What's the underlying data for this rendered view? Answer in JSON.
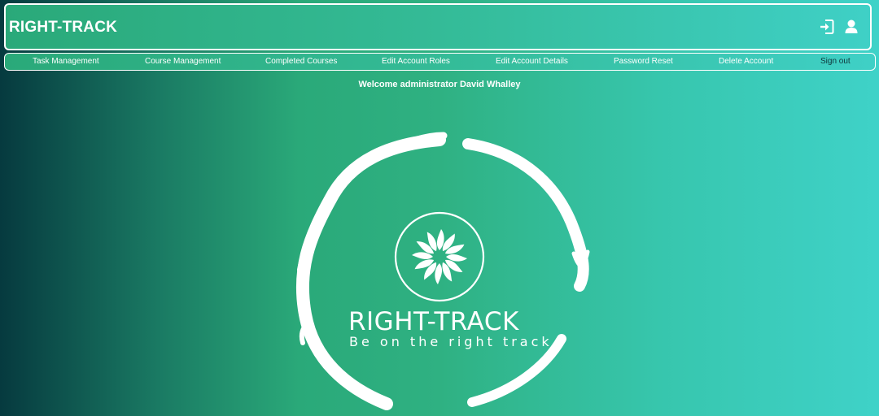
{
  "header": {
    "brand": "RIGHT-TRACK",
    "icons": [
      "sign-in-icon",
      "user-icon"
    ]
  },
  "nav": {
    "items": [
      {
        "label": "Task Management"
      },
      {
        "label": "Course Management"
      },
      {
        "label": "Completed Courses"
      },
      {
        "label": "Edit Account Roles"
      },
      {
        "label": "Edit Account Details"
      },
      {
        "label": "Password Reset"
      },
      {
        "label": "Delete Account"
      },
      {
        "label": "Sign out"
      }
    ]
  },
  "main": {
    "welcome": "Welcome administrator David Whalley",
    "logo": {
      "title": "RIGHT-TRACK",
      "tagline": "Be on the right track"
    }
  },
  "colors": {
    "accent": "#2fb182",
    "dark": "#063a3f",
    "light": "#3fd2c8",
    "text": "#ffffff"
  }
}
